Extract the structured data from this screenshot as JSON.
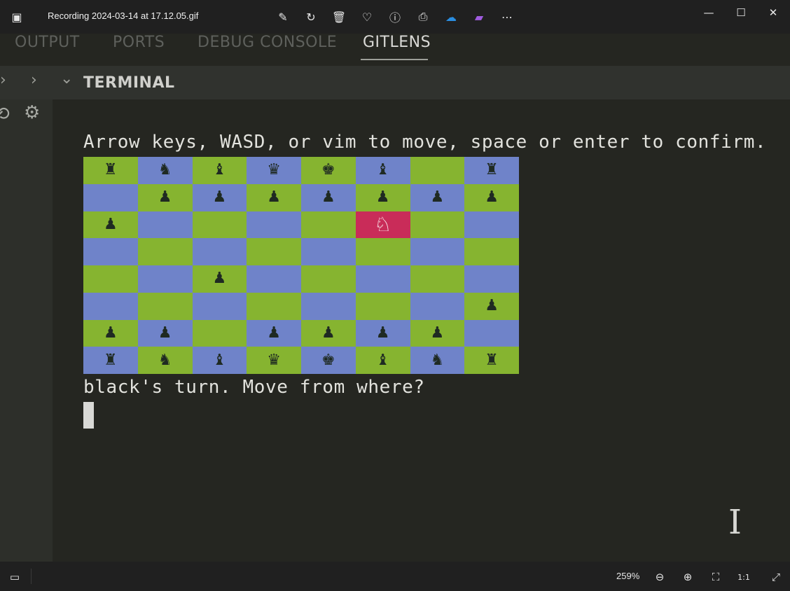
{
  "window": {
    "title": "Recording 2024-03-14 at 17.12.05.gif",
    "toolbar_icons": [
      "edit-image-icon",
      "rotate-icon",
      "delete-icon",
      "favorite-icon",
      "info-icon",
      "print-icon",
      "onedrive-icon",
      "clipchamp-icon",
      "more-icon"
    ],
    "controls": {
      "minimize": "—",
      "maximize": "☐",
      "close": "✕"
    }
  },
  "panel": {
    "tabs": [
      {
        "label": "OUTPUT",
        "active": false
      },
      {
        "label": "PORTS",
        "active": false
      },
      {
        "label": "DEBUG CONSOLE",
        "active": false
      },
      {
        "label": "GITLENS",
        "active": true
      }
    ],
    "section_title": "TERMINAL"
  },
  "terminal": {
    "instruction": "Arrow keys, WASD, or vim to move, space or enter to confirm.",
    "prompt": "black's turn. Move from where?",
    "board": {
      "rows": [
        [
          "♜",
          "♞",
          "♝",
          "♛",
          "♚",
          "♝",
          "",
          "♜"
        ],
        [
          "",
          "♟",
          "♟",
          "♟",
          "♟",
          "♟",
          "♟",
          "♟"
        ],
        [
          "♟",
          "",
          "",
          "",
          "",
          "♞",
          "",
          ""
        ],
        [
          "",
          "",
          "",
          "",
          "",
          "",
          "",
          ""
        ],
        [
          "",
          "",
          "♟",
          "",
          "",
          "",
          "",
          ""
        ],
        [
          "",
          "",
          "",
          "",
          "",
          "",
          "",
          "♟"
        ],
        [
          "♟",
          "♟",
          "",
          "♟",
          "♟",
          "♟",
          "♟",
          ""
        ],
        [
          "♜",
          "♞",
          "♝",
          "♛",
          "♚",
          "♝",
          "♞",
          "♜"
        ]
      ],
      "highlight": {
        "row": 2,
        "col": 5
      },
      "light_color": "#86b430",
      "dark_color": "#6f83c9",
      "highlight_color": "#c92c59"
    }
  },
  "statusbar": {
    "zoom": "259%"
  }
}
